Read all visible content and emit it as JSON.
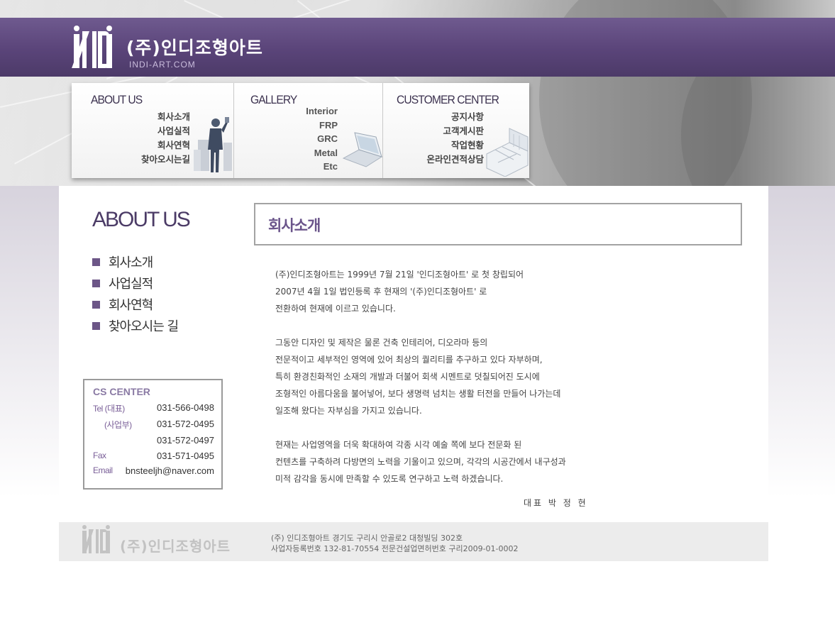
{
  "header": {
    "brand_name": "(주)인디조형아트",
    "brand_url": "INDI-ART.COM"
  },
  "menu": [
    {
      "title": "ABOUT US",
      "links": [
        "회사소개",
        "사업실적",
        "회사연혁",
        "찾아오시는길"
      ]
    },
    {
      "title": "GALLERY",
      "links": [
        "Interior",
        "FRP",
        "GRC",
        "Metal",
        "Etc"
      ]
    },
    {
      "title": "CUSTOMER CENTER",
      "links": [
        "공지사항",
        "고객게시판",
        "작업현황",
        "온라인견적상담"
      ]
    }
  ],
  "sidebar": {
    "title": "ABOUT US",
    "items": [
      "회사소개",
      "사업실적",
      "회사연혁",
      "찾아오시는 길"
    ]
  },
  "cs_center": {
    "title": "CS CENTER",
    "rows": [
      {
        "label": "Tel (대표)",
        "value": "031-566-0498"
      },
      {
        "label": "(사업부)",
        "value": "031-572-0495"
      },
      {
        "label": "",
        "value": "031-572-0497"
      },
      {
        "label": "Fax",
        "value": "031-571-0495"
      },
      {
        "label": "Email",
        "value": "bnsteeljh@naver.com"
      }
    ]
  },
  "main": {
    "heading": "회사소개",
    "paragraphs": [
      [
        "(주)인디조형아트는 1999년 7월 21일 '인디조형아트' 로 첫 창립되어",
        "2007년 4월 1일 법인등록 후 현재의 '(주)인디조형아트' 로",
        "전환하여 현재에 이르고 있습니다."
      ],
      [
        "그동안 디자인 및 제작은 물론 건축 인테리어, 디오라마 등의",
        "전문적이고 세부적인 영역에 있어 최상의 퀄리티를 추구하고 있다 자부하며,",
        "특히 환경친화적인 소재의 개발과 더불어 회색 시멘트로 덧칠되어진 도시에",
        "조형적인 아름다움을 불어넣어, 보다 생명력 넘치는 생활 터전을 만들어 나가는데",
        "일조해 왔다는 자부심을 가지고 있습니다."
      ],
      [
        "현재는 사업영역을 더욱 확대하여 각종 시각 예술 쪽에 보다 전문화 된",
        "컨텐츠를 구축하려 다방면의 노력을 기울이고 있으며, 각각의 시공간에서 내구성과",
        "미적 감각을 동시에 만족할 수 있도록 연구하고 노력 하겠습니다."
      ]
    ],
    "signature": "대표 박 정 현"
  },
  "footer": {
    "brand_name": "(주)인디조형아트",
    "lines": [
      "(주) 인디조형아트 경기도 구리시 안골로2 대청빌딩 302호",
      "사업자등록번호 132-81-70554  전문건설업면허번호 구리2009-01-0002"
    ]
  },
  "colors": {
    "brand_purple": "#5a4479",
    "accent_purple": "#6a548a",
    "bullet": "#6c5687"
  }
}
